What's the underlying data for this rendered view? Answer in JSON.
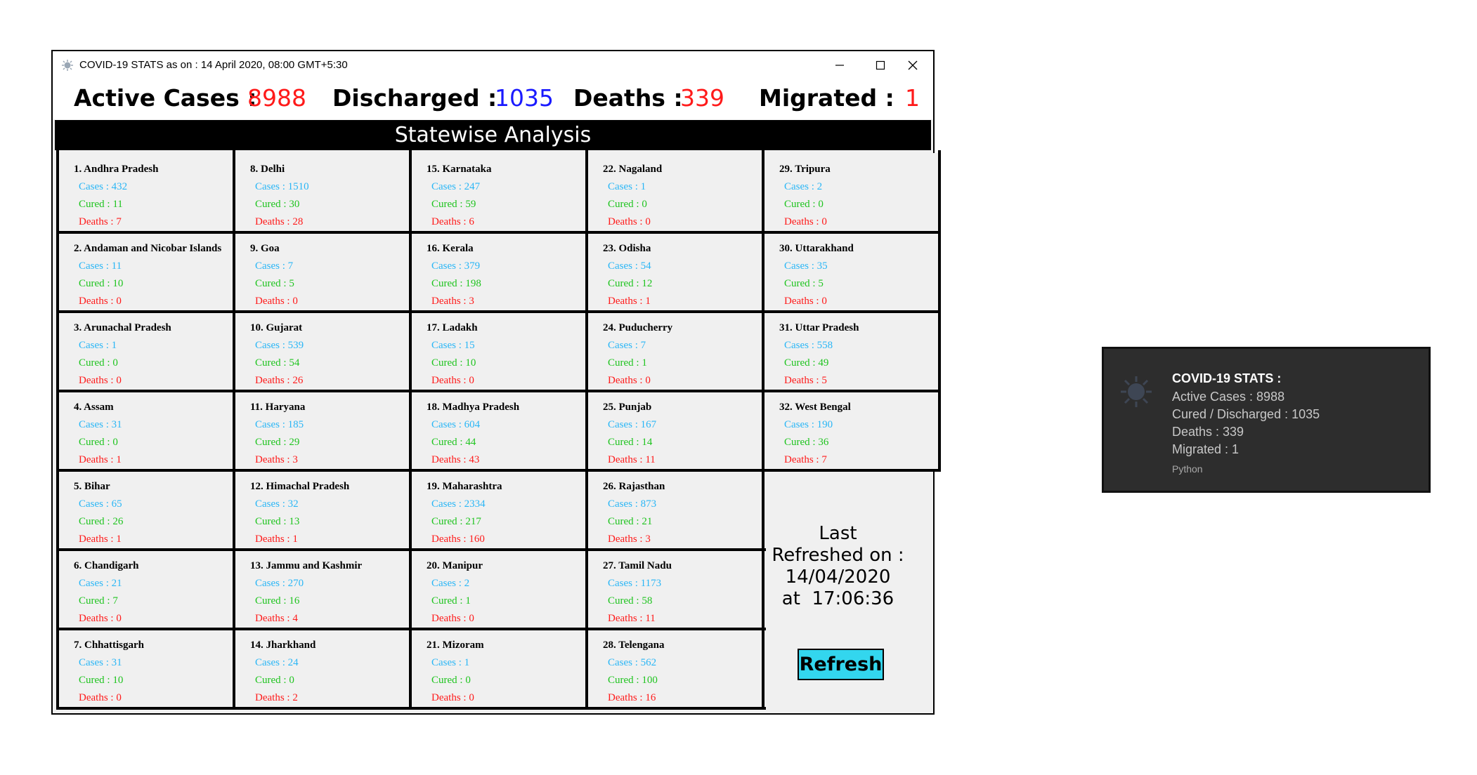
{
  "window": {
    "title": "COVID-19 STATS as on : 14 April 2020, 08:00 GMT+5:30",
    "controls": [
      "minimize",
      "maximize",
      "close"
    ]
  },
  "summary": {
    "active_label": "Active Cases :",
    "active_value": "8988",
    "discharged_label": "Discharged  :",
    "discharged_value": "1035",
    "deaths_label": "Deaths :",
    "deaths_value": "339",
    "migrated_label": "Migrated :",
    "migrated_value": "1"
  },
  "section_header": "Statewise Analysis",
  "colors": {
    "cases": "#29b6f6",
    "cured": "#1fc41f",
    "deaths": "#ff1a1a",
    "summary_red": "#ff1a1a",
    "summary_blue": "#1a1aff",
    "refresh_button": "#33d6ee"
  },
  "states": [
    {
      "name": "1. Andhra Pradesh",
      "cases": "Cases : 432",
      "cured": "Cured : 11",
      "deaths": "Deaths : 7"
    },
    {
      "name": "2. Andaman and Nicobar Islands",
      "cases": "Cases : 11",
      "cured": "Cured : 10",
      "deaths": "Deaths : 0"
    },
    {
      "name": "3. Arunachal Pradesh",
      "cases": "Cases : 1",
      "cured": "Cured : 0",
      "deaths": "Deaths : 0"
    },
    {
      "name": "4. Assam",
      "cases": "Cases : 31",
      "cured": "Cured : 0",
      "deaths": "Deaths : 1"
    },
    {
      "name": "5. Bihar",
      "cases": "Cases : 65",
      "cured": "Cured : 26",
      "deaths": "Deaths : 1"
    },
    {
      "name": "6. Chandigarh",
      "cases": "Cases : 21",
      "cured": "Cured : 7",
      "deaths": "Deaths : 0"
    },
    {
      "name": "7. Chhattisgarh",
      "cases": "Cases : 31",
      "cured": "Cured : 10",
      "deaths": "Deaths : 0"
    },
    {
      "name": "8. Delhi",
      "cases": "Cases : 1510",
      "cured": "Cured : 30",
      "deaths": "Deaths : 28"
    },
    {
      "name": "9. Goa",
      "cases": "Cases : 7",
      "cured": "Cured : 5",
      "deaths": "Deaths : 0"
    },
    {
      "name": "10. Gujarat",
      "cases": "Cases : 539",
      "cured": "Cured : 54",
      "deaths": "Deaths : 26"
    },
    {
      "name": "11. Haryana",
      "cases": "Cases : 185",
      "cured": "Cured : 29",
      "deaths": "Deaths : 3"
    },
    {
      "name": "12. Himachal Pradesh",
      "cases": "Cases : 32",
      "cured": "Cured : 13",
      "deaths": "Deaths : 1"
    },
    {
      "name": "13. Jammu and Kashmir",
      "cases": "Cases : 270",
      "cured": "Cured : 16",
      "deaths": "Deaths : 4"
    },
    {
      "name": "14. Jharkhand",
      "cases": "Cases : 24",
      "cured": "Cured : 0",
      "deaths": "Deaths : 2"
    },
    {
      "name": "15. Karnataka",
      "cases": "Cases : 247",
      "cured": "Cured : 59",
      "deaths": "Deaths : 6"
    },
    {
      "name": "16. Kerala",
      "cases": "Cases : 379",
      "cured": "Cured : 198",
      "deaths": "Deaths : 3"
    },
    {
      "name": "17. Ladakh",
      "cases": "Cases : 15",
      "cured": "Cured : 10",
      "deaths": "Deaths : 0"
    },
    {
      "name": "18. Madhya Pradesh",
      "cases": "Cases : 604",
      "cured": "Cured : 44",
      "deaths": "Deaths : 43"
    },
    {
      "name": "19. Maharashtra",
      "cases": "Cases : 2334",
      "cured": "Cured : 217",
      "deaths": "Deaths : 160"
    },
    {
      "name": "20. Manipur",
      "cases": "Cases : 2",
      "cured": "Cured : 1",
      "deaths": "Deaths : 0"
    },
    {
      "name": "21. Mizoram",
      "cases": "Cases : 1",
      "cured": "Cured : 0",
      "deaths": "Deaths : 0"
    },
    {
      "name": "22. Nagaland",
      "cases": "Cases : 1",
      "cured": "Cured : 0",
      "deaths": "Deaths : 0"
    },
    {
      "name": "23. Odisha",
      "cases": "Cases : 54",
      "cured": "Cured : 12",
      "deaths": "Deaths : 1"
    },
    {
      "name": "24. Puducherry",
      "cases": "Cases : 7",
      "cured": "Cured : 1",
      "deaths": "Deaths : 0"
    },
    {
      "name": "25. Punjab",
      "cases": "Cases : 167",
      "cured": "Cured : 14",
      "deaths": "Deaths : 11"
    },
    {
      "name": "26. Rajasthan",
      "cases": "Cases : 873",
      "cured": "Cured : 21",
      "deaths": "Deaths : 3"
    },
    {
      "name": "27. Tamil Nadu",
      "cases": "Cases : 1173",
      "cured": "Cured : 58",
      "deaths": "Deaths : 11"
    },
    {
      "name": "28. Telengana",
      "cases": "Cases : 562",
      "cured": "Cured : 100",
      "deaths": "Deaths : 16"
    },
    {
      "name": "29. Tripura",
      "cases": "Cases : 2",
      "cured": "Cured : 0",
      "deaths": "Deaths : 0"
    },
    {
      "name": "30. Uttarakhand",
      "cases": "Cases : 35",
      "cured": "Cured : 5",
      "deaths": "Deaths : 0"
    },
    {
      "name": "31. Uttar Pradesh",
      "cases": "Cases : 558",
      "cured": "Cured : 49",
      "deaths": "Deaths : 5"
    },
    {
      "name": "32. West Bengal",
      "cases": "Cases : 190",
      "cured": "Cured : 36",
      "deaths": "Deaths : 7"
    }
  ],
  "refresh": {
    "line1": "Last",
    "line2": "Refreshed on :",
    "line3": "14/04/2020",
    "line4": "at  17:06:36",
    "button_label": "Refresh"
  },
  "toast": {
    "icon": "virus-icon",
    "title": "COVID-19 STATS :",
    "lines": [
      "Active Cases : 8988",
      "Cured / Discharged  : 1035",
      "Deaths : 339",
      "Migrated : 1"
    ],
    "app_name": "Python"
  }
}
